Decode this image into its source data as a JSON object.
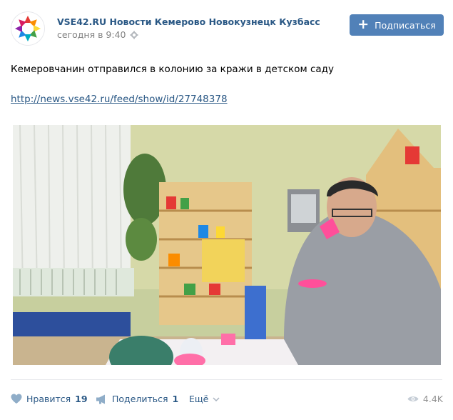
{
  "publisher": {
    "name": "VSE42.RU Новости Кемерово Новокузнецк Кузбасс",
    "time": "сегодня в 9:40",
    "subscribe_label": "Подписаться"
  },
  "post": {
    "text": "Кемеровчанин отправился в колонию за кражи в детском саду",
    "link": "http://news.vse42.ru/feed/show/id/27748378"
  },
  "footer": {
    "like_label": "Нравится",
    "like_count": "19",
    "share_label": "Поделиться",
    "share_count": "1",
    "more_label": "Ещё",
    "views": "4.4K"
  },
  "colors": {
    "accent": "#5181b8",
    "link": "#2a5885",
    "muted": "#828282"
  }
}
